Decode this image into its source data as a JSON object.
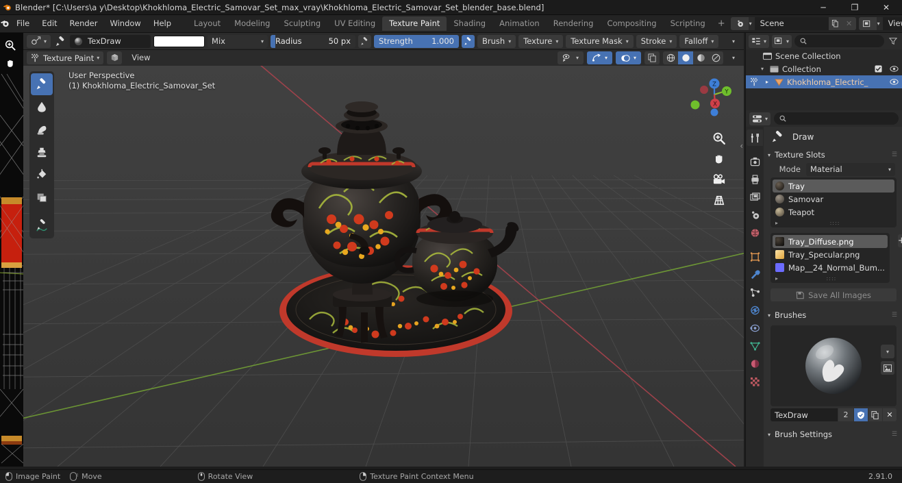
{
  "window": {
    "title": "Blender* [C:\\Users\\a y\\Desktop\\Khokhloma_Electric_Samovar_Set_max_vray\\Khokhloma_Electric_Samovar_Set_blender_base.blend]",
    "minimize": "─",
    "maximize": "❐",
    "close": "✕"
  },
  "topbar": {
    "menus": [
      "File",
      "Edit",
      "Render",
      "Window",
      "Help"
    ],
    "workspaces": [
      {
        "label": "Layout",
        "active": false
      },
      {
        "label": "Modeling",
        "active": false
      },
      {
        "label": "Sculpting",
        "active": false
      },
      {
        "label": "UV Editing",
        "active": false
      },
      {
        "label": "Texture Paint",
        "active": true
      },
      {
        "label": "Shading",
        "active": false
      },
      {
        "label": "Animation",
        "active": false
      },
      {
        "label": "Rendering",
        "active": false
      },
      {
        "label": "Compositing",
        "active": false
      },
      {
        "label": "Scripting",
        "active": false
      }
    ],
    "add_workspace": "+",
    "scene_name": "Scene",
    "view_layer_name": "View Layer"
  },
  "tool_header": {
    "brush_name": "TexDraw",
    "brush_color": "#ffffff",
    "blend_mode": "Mix",
    "radius_label": "Radius",
    "radius_value": "50 px",
    "radius_fill_pct": 6,
    "strength_label": "Strength",
    "strength_value": "1.000",
    "strength_fill_pct": 100,
    "popovers": [
      "Brush",
      "Texture",
      "Texture Mask",
      "Stroke",
      "Falloff"
    ]
  },
  "mode_header": {
    "mode": "Texture Paint",
    "view_menu": "View"
  },
  "viewport": {
    "perspective_label": "User Perspective",
    "object_label": "(1) Khokhloma_Electric_Samovar_Set",
    "tools": [
      {
        "name": "draw-tool",
        "active": true
      },
      {
        "name": "soften-tool",
        "active": false
      },
      {
        "name": "smear-tool",
        "active": false
      },
      {
        "name": "clone-tool",
        "active": false
      },
      {
        "name": "fill-tool",
        "active": false
      },
      {
        "name": "mask-tool",
        "active": false
      },
      {
        "name": "annotate-tool",
        "active": false
      }
    ],
    "gizmo_axes": [
      "Z",
      "Y",
      "X"
    ],
    "nav_buttons": [
      "zoom-icon",
      "pan-hand-icon",
      "camera-icon",
      "perspective-grid-icon"
    ]
  },
  "outliner": {
    "search_placeholder": "",
    "rows": [
      {
        "label": "Scene Collection",
        "depth": 0,
        "icon": "collection-icon",
        "selected": false,
        "disclosure": "",
        "checkbox": false,
        "eye": false
      },
      {
        "label": "Collection",
        "depth": 1,
        "icon": "collection-icon",
        "selected": false,
        "disclosure": "▾",
        "checkbox": true,
        "eye": true
      },
      {
        "label": "Khokhloma_Electric_",
        "depth": 2,
        "icon": "mesh-object-icon",
        "selected": true,
        "disclosure": "▸",
        "checkbox": false,
        "eye": true
      }
    ]
  },
  "properties": {
    "search_placeholder": "",
    "tool_name": "Draw",
    "texture_slots": {
      "title": "Texture Slots",
      "mode_label": "Mode",
      "mode_value": "Material",
      "materials": [
        {
          "label": "Tray",
          "color": "#2b2018",
          "selected": true
        },
        {
          "label": "Samovar",
          "color": "#6a6258",
          "selected": false
        },
        {
          "label": "Teapot",
          "color": "#8a7f6c",
          "selected": false
        }
      ],
      "textures": [
        {
          "label": "Tray_Diffuse.png",
          "color": "#1a1a1a",
          "selected": true
        },
        {
          "label": "Tray_Specular.png",
          "color": "#f2c878",
          "selected": false
        },
        {
          "label": "Map__24_Normal_Bum...",
          "color": "#6b6bff",
          "selected": false
        }
      ],
      "add_button": "+",
      "save_all_label": "Save All Images"
    },
    "brushes": {
      "title": "Brushes",
      "brush_name": "TexDraw",
      "users_count": "2",
      "fake_user": "shield-icon",
      "duplicate": "copy-icon",
      "unlink": "✕"
    },
    "brush_settings_title": "Brush Settings",
    "tabs": [
      "tool-tab",
      "render-tab",
      "output-tab",
      "view-layer-tab",
      "scene-tab",
      "world-tab",
      "object-tab",
      "modifier-tab",
      "particles-tab",
      "physics-tab",
      "constraint-tab",
      "data-tab",
      "material-tab",
      "texture-tab"
    ]
  },
  "statusbar": {
    "items": [
      {
        "icon": "mouse-left-icon",
        "label": "Image Paint"
      },
      {
        "icon": "mouse-move-icon",
        "label": "Move"
      },
      {
        "icon": "mouse-middle-icon",
        "label": "Rotate View"
      },
      {
        "icon": "mouse-right-icon",
        "label": "Texture Paint Context Menu"
      }
    ],
    "version": "2.91.0"
  },
  "colors": {
    "accent_blue": "#4772b3",
    "header_bg": "#2b2b2b",
    "viewport_bg": "#3b3b3b",
    "panel_bg": "#303030",
    "outliner_bg": "#282828",
    "axis_x": "#cf4049",
    "axis_y": "#8fbd32",
    "axis_z": "#3e7fd8"
  }
}
